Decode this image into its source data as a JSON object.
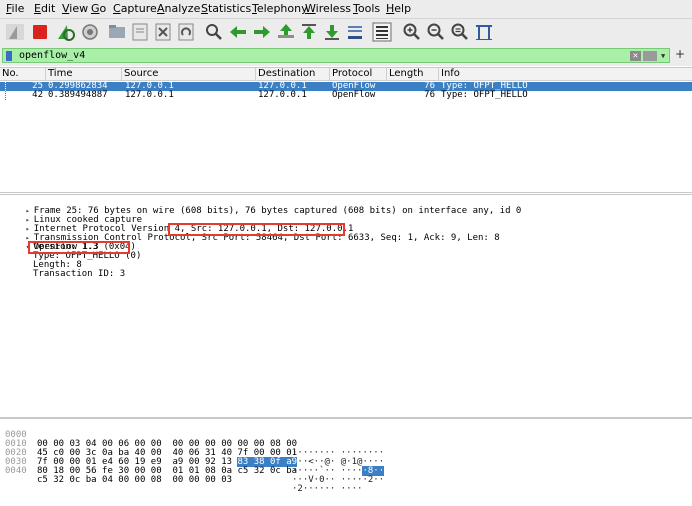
{
  "menubar": {
    "items": [
      "File",
      "Edit",
      "View",
      "Go",
      "Capture",
      "Analyze",
      "Statistics",
      "Telephony",
      "Wireless",
      "Tools",
      "Help"
    ]
  },
  "toolbar": {
    "icons": [
      "shark-fin-start-icon",
      "stop-capture-icon",
      "restart-capture-icon",
      "capture-options-icon",
      "open-file-icon",
      "save-file-icon",
      "close-file-icon",
      "reload-file-icon",
      "find-packet-icon",
      "go-back-icon",
      "go-forward-icon",
      "go-to-packet-icon",
      "go-first-icon",
      "go-last-icon",
      "autoscroll-icon",
      "colorize-icon",
      "zoom-in-icon",
      "zoom-out-icon",
      "zoom-normal-icon",
      "resize-columns-icon"
    ]
  },
  "filter": {
    "value": "openflow_v4",
    "clear_glyph": "✕",
    "dropdown_glyph": "▼",
    "add_glyph": "+"
  },
  "packet_list": {
    "columns": [
      "No.",
      "Time",
      "Source",
      "Destination",
      "Protocol",
      "Length",
      "Info"
    ],
    "rows": [
      {
        "no": "25",
        "time": "0.299862834",
        "source": "127.0.0.1",
        "destination": "127.0.0.1",
        "protocol": "OpenFlow",
        "length": "76",
        "info": "Type: OFPT_HELLO"
      },
      {
        "no": "42",
        "time": "0.389494887",
        "source": "127.0.0.1",
        "destination": "127.0.0.1",
        "protocol": "OpenFlow",
        "length": "76",
        "info": "Type: OFPT_HELLO"
      }
    ]
  },
  "details": {
    "frame": "Frame 25: 76 bytes on wire (608 bits), 76 bytes captured (608 bits) on interface any, id 0",
    "linux": "Linux cooked capture",
    "ip": "Internet Protocol Version 4, Src: 127.0.0.1, Dst: 127.0.0.1",
    "tcp_prefix": "Transmission Control Protocol,",
    "tcp_ports": "Src Port: 58464, Dst Port: 6633,",
    "tcp_suffix": "Seq: 1, Ack: 9, Len: 8",
    "openflow": "OpenFlow 1.3",
    "version": "Version: 1.3 (0x04)",
    "type": "Type: OFPT_HELLO (0)",
    "length": "Length: 8",
    "xid": "Transaction ID: 3",
    "arrow_collapsed": "▸",
    "arrow_expanded": "▾"
  },
  "hex": {
    "rows": [
      {
        "offset": "0000",
        "pre": "00 00 03 04 00 06 00 00  00 00 00 00 00 00 08 00",
        "hl": "",
        "post": "",
        "ascii_pre": "········ ········",
        "ascii_hl": "",
        "ascii_post": ""
      },
      {
        "offset": "0010",
        "pre": "45 c0 00 3c 0a ba 40 00  40 06 31 40 7f 00 00 01",
        "hl": "",
        "post": "",
        "ascii_pre": "E··<··@· @·1@····",
        "ascii_hl": "",
        "ascii_post": ""
      },
      {
        "offset": "0020",
        "pre": "7f 00 00 01 e4 60 19 e9  a9 00 92 13 ",
        "hl": "83 38 0f a9",
        "post": "",
        "ascii_pre": "·····`·· ····",
        "ascii_hl": "·8··",
        "ascii_post": ""
      },
      {
        "offset": "0030",
        "pre": "80 18 00 56 fe 30 00 00  01 01 08 0a c5 32 0c ba",
        "hl": "",
        "post": "",
        "ascii_pre": "···V·0·· ·····2··",
        "ascii_hl": "",
        "ascii_post": ""
      },
      {
        "offset": "0040",
        "pre": "c5 32 0c ba 04 00 00 08  00 00 00 03",
        "hl": "",
        "post": "",
        "ascii_pre": "·2······ ····",
        "ascii_hl": "",
        "ascii_post": ""
      }
    ]
  },
  "colors": {
    "selection": "#3b7fc4",
    "filter_bg": "#a8f0a8",
    "annotation": "#e53a2f"
  }
}
